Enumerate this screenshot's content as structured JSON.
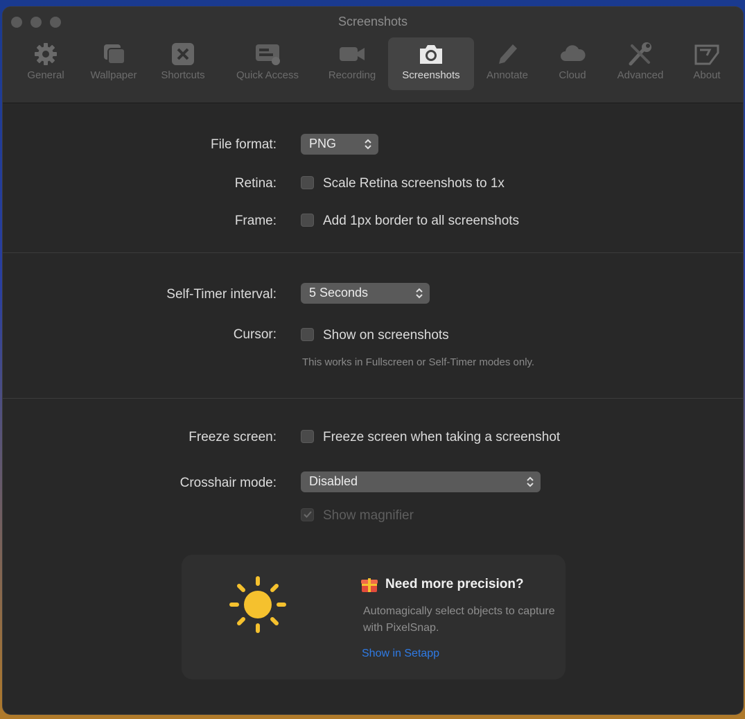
{
  "window": {
    "title": "Screenshots"
  },
  "tabs": [
    {
      "label": "General",
      "icon": "gear-icon"
    },
    {
      "label": "Wallpaper",
      "icon": "wallpaper-icon"
    },
    {
      "label": "Shortcuts",
      "icon": "shortcuts-icon"
    },
    {
      "label": "Quick Access",
      "icon": "quick-access-icon"
    },
    {
      "label": "Recording",
      "icon": "video-camera-icon"
    },
    {
      "label": "Screenshots",
      "icon": "camera-icon",
      "active": true
    },
    {
      "label": "Annotate",
      "icon": "pencil-icon"
    },
    {
      "label": "Cloud",
      "icon": "cloud-icon"
    },
    {
      "label": "Advanced",
      "icon": "tools-icon"
    },
    {
      "label": "About",
      "icon": "about-icon"
    }
  ],
  "settings": {
    "file_format": {
      "label": "File format:",
      "value": "PNG"
    },
    "retina": {
      "label": "Retina:",
      "checkbox_label": "Scale Retina screenshots to 1x",
      "checked": false
    },
    "frame": {
      "label": "Frame:",
      "checkbox_label": "Add 1px border to all screenshots",
      "checked": false
    },
    "self_timer": {
      "label": "Self-Timer interval:",
      "value": "5 Seconds"
    },
    "cursor": {
      "label": "Cursor:",
      "checkbox_label": "Show on screenshots",
      "checked": false,
      "hint": "This works in Fullscreen or Self-Timer modes only."
    },
    "freeze": {
      "label": "Freeze screen:",
      "checkbox_label": "Freeze screen when taking a screenshot",
      "checked": false
    },
    "crosshair": {
      "label": "Crosshair mode:",
      "value": "Disabled"
    },
    "magnifier": {
      "checkbox_label": "Show magnifier",
      "checked": true,
      "disabled": true
    }
  },
  "promo": {
    "title": "Need more precision?",
    "description": "Automagically select objects to capture with PixelSnap.",
    "link": "Show in Setapp"
  },
  "colors": {
    "accent_link": "#2f7be6",
    "sun": "#f5c12e",
    "background": "#282828"
  }
}
